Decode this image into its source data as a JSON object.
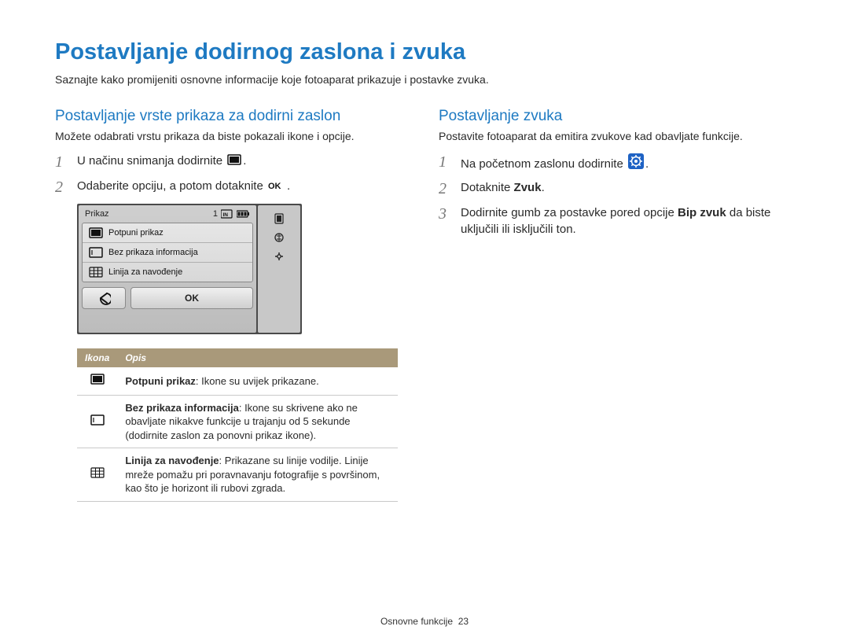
{
  "title": "Postavljanje dodirnog zaslona i zvuka",
  "intro": "Saznajte kako promijeniti osnovne informacije koje fotoaparat prikazuje i postavke zvuka.",
  "left": {
    "heading": "Postavljanje vrste prikaza za dodirni zaslon",
    "sub": "Možete odabrati vrstu prikaza da biste pokazali ikone i opcije.",
    "steps": {
      "s1_num": "1",
      "s1_text_a": "U načinu snimanja dodirnite ",
      "s1_text_b": ".",
      "s2_num": "2",
      "s2_text_a": "Odaberite opciju, a potom dotaknite ",
      "s2_text_b": "."
    },
    "device": {
      "header": "Prikaz",
      "counter": "1",
      "opt1": "Potpuni prikaz",
      "opt2": "Bez prikaza informacija",
      "opt3": "Linija za navođenje",
      "ok": "OK"
    },
    "table": {
      "h_icon": "Ikona",
      "h_desc": "Opis",
      "r1_b": "Potpuni prikaz",
      "r1_t": ": Ikone su uvijek prikazane.",
      "r2_b": "Bez prikaza informacija",
      "r2_t": ": Ikone su skrivene ako ne obavljate nikakve funkcije u trajanju od 5 sekunde (dodirnite zaslon za ponovni prikaz ikone).",
      "r3_b": "Linija za navođenje",
      "r3_t": ": Prikazane su linije vodilje. Linije mreže pomažu pri poravnavanju fotografije s površinom, kao što je horizont ili rubovi zgrada."
    }
  },
  "right": {
    "heading": "Postavljanje zvuka",
    "sub": "Postavite fotoaparat da emitira zvukove kad obavljate funkcije.",
    "steps": {
      "s1_num": "1",
      "s1_text_a": "Na početnom zaslonu dodirnite ",
      "s1_text_b": ".",
      "s2_num": "2",
      "s2_text_a": "Dotaknite ",
      "s2_text_b": "Zvuk",
      "s2_text_c": ".",
      "s3_num": "3",
      "s3_text_a": "Dodirnite gumb za postavke pored opcije ",
      "s3_text_b": "Bip zvuk",
      "s3_text_c": " da biste uključili ili isključili ton."
    }
  },
  "footer": {
    "section": "Osnovne funkcije",
    "page": "23"
  }
}
